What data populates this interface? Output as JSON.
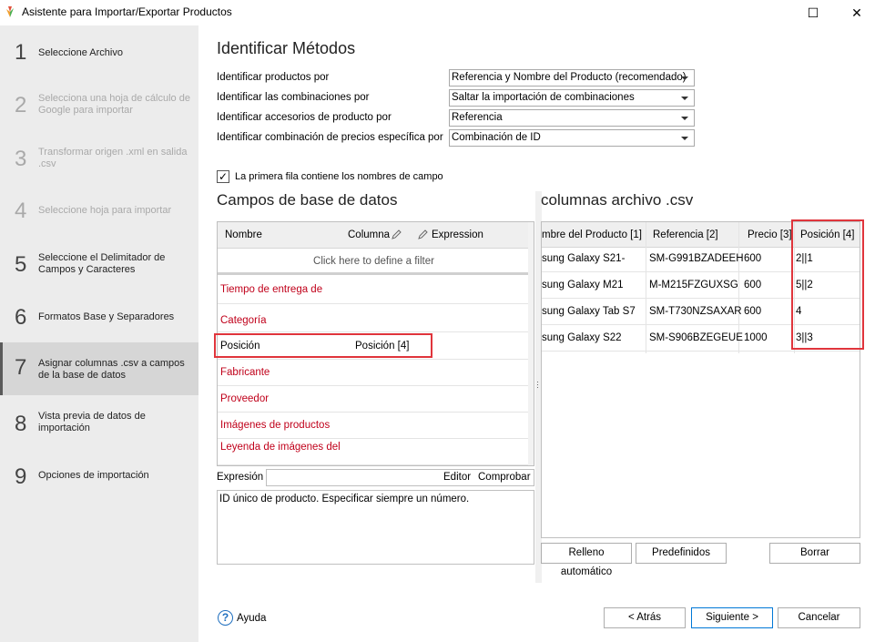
{
  "window": {
    "title": "Asistente para Importar/Exportar Productos",
    "maximize_glyph": "☐",
    "close_glyph": "✕"
  },
  "sidebar": {
    "steps": [
      {
        "num": "1",
        "label": "Seleccione Archivo",
        "state": "normal"
      },
      {
        "num": "2",
        "label": "Selecciona una hoja de cálculo de Google para importar",
        "state": "disabled"
      },
      {
        "num": "3",
        "label": "Transformar origen .xml en salida .csv",
        "state": "disabled"
      },
      {
        "num": "4",
        "label": "Seleccione hoja para importar",
        "state": "disabled"
      },
      {
        "num": "5",
        "label": "Seleccione el Delimitador de Campos y Caracteres",
        "state": "normal"
      },
      {
        "num": "6",
        "label": "Formatos Base y Separadores",
        "state": "normal"
      },
      {
        "num": "7",
        "label": "Asignar columnas .csv a campos de la base de datos",
        "state": "active"
      },
      {
        "num": "8",
        "label": "Vista previa de datos de importación",
        "state": "normal"
      },
      {
        "num": "9",
        "label": "Opciones de importación",
        "state": "normal"
      }
    ]
  },
  "identify": {
    "title": "Identificar Métodos",
    "rows": [
      {
        "label": "Identificar productos por",
        "value": "Referencia y Nombre del Producto (recomendado)"
      },
      {
        "label": "Identificar las combinaciones por",
        "value": "Saltar la importación de combinaciones"
      },
      {
        "label": "Identificar accesorios de producto por",
        "value": "Referencia"
      },
      {
        "label": "Identificar combinación de precios específica por",
        "value": "Combinación de ID"
      }
    ],
    "first_row_headers": {
      "checked": true,
      "label": "La primera fila contiene los nombres de campo",
      "check_glyph": "✓"
    }
  },
  "db_fields": {
    "title": "Campos de base de datos",
    "headers": {
      "name": "Nombre",
      "column": "Columna",
      "expression": "Expression"
    },
    "filter_text": "Click here to define a filter",
    "rows": [
      {
        "name": "Tiempo de entrega de",
        "column": "",
        "mapped": false
      },
      {
        "name": "Categoría",
        "column": "",
        "mapped": false
      },
      {
        "name": "Posición",
        "column": "Posición [4]",
        "mapped": true
      },
      {
        "name": "Fabricante",
        "column": "",
        "mapped": false
      },
      {
        "name": "Proveedor",
        "column": "",
        "mapped": false
      },
      {
        "name": "Imágenes de productos",
        "column": "",
        "mapped": false
      },
      {
        "name": "Leyenda de imágenes del",
        "column": "",
        "mapped": false
      }
    ]
  },
  "expression": {
    "label": "Expresión",
    "editor_link": "Editor",
    "check_link": "Comprobar",
    "description": "ID único de producto. Especificar siempre un número."
  },
  "csv": {
    "title": "columnas archivo .csv",
    "headers": [
      "mbre del Producto [1]",
      "Referencia [2]",
      "Precio [3]",
      "Posición [4]"
    ],
    "rows": [
      [
        "sung Galaxy S21-",
        "SM-G991BZADEEH",
        "600",
        "2||1"
      ],
      [
        "sung Galaxy M21",
        "M-M215FZGUXSG",
        "600",
        "5||2"
      ],
      [
        "sung Galaxy Tab S7",
        "SM-T730NZSAXAR",
        "600",
        "4"
      ],
      [
        "sung Galaxy S22",
        "SM-S906BZEGEUE",
        "1000",
        "3||3"
      ]
    ],
    "buttons": {
      "autofill": "Relleno automático",
      "presets": "Predefinidos",
      "clear": "Borrar"
    }
  },
  "footer": {
    "help": "Ayuda",
    "help_glyph": "?",
    "back": "< Atrás",
    "next": "Siguiente >",
    "cancel": "Cancelar"
  },
  "colors": {
    "highlight": "#e0353c",
    "unmapped_field": "#c0001a",
    "sidebar_bg": "#ececec"
  }
}
